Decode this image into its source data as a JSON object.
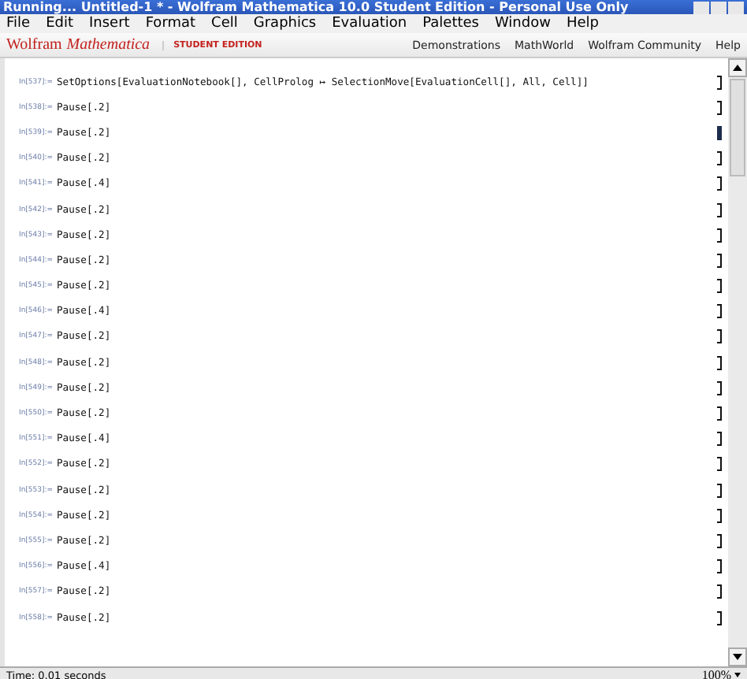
{
  "window": {
    "title": "Running... Untitled-1 * - Wolfram Mathematica 10.0 Student Edition - Personal Use Only"
  },
  "menu": [
    "File",
    "Edit",
    "Insert",
    "Format",
    "Cell",
    "Graphics",
    "Evaluation",
    "Palettes",
    "Window",
    "Help"
  ],
  "header": {
    "brand": "Wolfram",
    "product": "Mathematica",
    "edition": "STUDENT EDITION",
    "links": [
      "Demonstrations",
      "MathWorld",
      "Wolfram Community",
      "Help"
    ]
  },
  "cells": [
    {
      "label": "In[537]:=",
      "code": "SetOptions[EvaluationNotebook[], CellProlog ↦ SelectionMove[EvaluationCell[], All, Cell]]",
      "selected": false
    },
    {
      "label": "In[538]:=",
      "code": "Pause[.2]",
      "selected": false
    },
    {
      "label": "In[539]:=",
      "code": "Pause[.2]",
      "selected": true
    },
    {
      "label": "In[540]:=",
      "code": "Pause[.2]",
      "selected": false
    },
    {
      "label": "In[541]:=",
      "code": "Pause[.4]",
      "selected": false
    },
    {
      "label": "In[542]:=",
      "code": "Pause[.2]",
      "selected": false
    },
    {
      "label": "In[543]:=",
      "code": "Pause[.2]",
      "selected": false
    },
    {
      "label": "In[544]:=",
      "code": "Pause[.2]",
      "selected": false
    },
    {
      "label": "In[545]:=",
      "code": "Pause[.2]",
      "selected": false
    },
    {
      "label": "In[546]:=",
      "code": "Pause[.4]",
      "selected": false
    },
    {
      "label": "In[547]:=",
      "code": "Pause[.2]",
      "selected": false
    },
    {
      "label": "In[548]:=",
      "code": "Pause[.2]",
      "selected": false
    },
    {
      "label": "In[549]:=",
      "code": "Pause[.2]",
      "selected": false
    },
    {
      "label": "In[550]:=",
      "code": "Pause[.2]",
      "selected": false
    },
    {
      "label": "In[551]:=",
      "code": "Pause[.4]",
      "selected": false
    },
    {
      "label": "In[552]:=",
      "code": "Pause[.2]",
      "selected": false
    },
    {
      "label": "In[553]:=",
      "code": "Pause[.2]",
      "selected": false
    },
    {
      "label": "In[554]:=",
      "code": "Pause[.2]",
      "selected": false
    },
    {
      "label": "In[555]:=",
      "code": "Pause[.2]",
      "selected": false
    },
    {
      "label": "In[556]:=",
      "code": "Pause[.4]",
      "selected": false
    },
    {
      "label": "In[557]:=",
      "code": "Pause[.2]",
      "selected": false
    },
    {
      "label": "In[558]:=",
      "code": "Pause[.2]",
      "selected": false
    }
  ],
  "status_bar": {
    "text": "Time: 0.01 seconds",
    "zoom": "100%"
  }
}
